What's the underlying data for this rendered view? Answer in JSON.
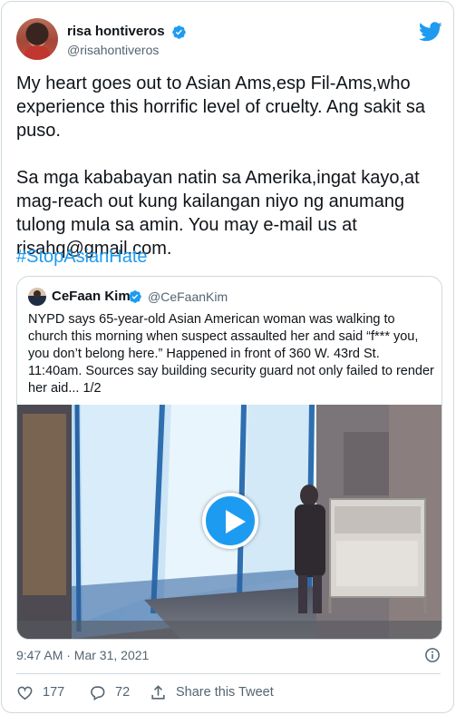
{
  "author": {
    "name": "risa hontiveros",
    "handle": "@risahontiveros"
  },
  "tweet": {
    "paragraph1": "My heart goes out to Asian Ams,esp Fil-Ams,who experience this horrific level of cruelty. Ang sakit sa puso.",
    "paragraph2": "Sa mga kababayan natin sa Amerika,ingat kayo,at mag-reach out kung kailangan niyo ng anumang tulong mula sa amin. You may e-mail us at risahq@gmail.com.",
    "hashtag": "#StopAsianHate"
  },
  "quoted_tweet": {
    "name": "CeFaan Kim",
    "handle": "@CeFaanKim",
    "text": "NYPD says 65-year-old Asian American woman was walking to church this morning when suspect assaulted her and said “f*** you, you don’t belong here.” Happened in front of 360 W. 43rd St. 11:40am. Sources say building security guard not only failed to render her aid... 1/2"
  },
  "meta": {
    "timestamp": "9:47 AM · Mar 31, 2021"
  },
  "actions": {
    "likes": "177",
    "replies": "72",
    "share_label": "Share this Tweet"
  },
  "colors": {
    "accent": "#1d9bf0",
    "secondary_text": "#536471",
    "border": "#cfd9de"
  },
  "icons": [
    "verified-badge-icon",
    "twitter-bird-icon",
    "play-icon",
    "info-icon",
    "heart-icon",
    "reply-icon",
    "share-icon"
  ]
}
